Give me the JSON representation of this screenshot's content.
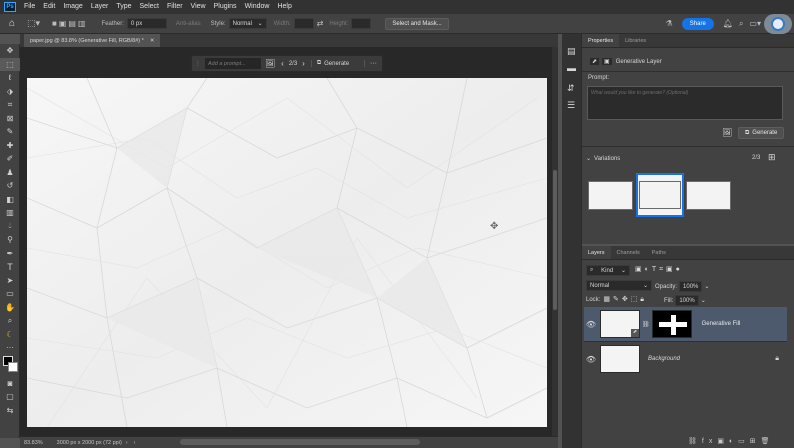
{
  "app": {
    "logo": "Ps"
  },
  "menu": [
    "File",
    "Edit",
    "Image",
    "Layer",
    "Type",
    "Select",
    "Filter",
    "View",
    "Plugins",
    "Window",
    "Help"
  ],
  "options": {
    "feather_label": "Feather:",
    "feather_value": "0 px",
    "anti_alias": "Anti-alias",
    "style_label": "Style:",
    "style_value": "Normal",
    "width_label": "Width:",
    "height_label": "Height:",
    "select_mask": "Select and Mask...",
    "share": "Share"
  },
  "document": {
    "tab_title": "paper.jpg @ 83.8% (Generative Fill, RGB/8#) *"
  },
  "context_bar": {
    "prompt_placeholder": "Add a prompt...",
    "counter": "2/3",
    "generate": "Generate",
    "more": "···"
  },
  "status": {
    "zoom": "83.83%",
    "dimensions": "3000 px x 2000 px (72 ppi)"
  },
  "properties": {
    "tabs": [
      "Properties",
      "Libraries"
    ],
    "layer_type": "Generative Layer",
    "prompt_label": "Prompt:",
    "prompt_placeholder": "What would you like to generate? (Optional)",
    "generate": "Generate",
    "variations_label": "Variations",
    "variations_count": "2/3",
    "selected_variation": 2
  },
  "layers": {
    "tabs": [
      "Layers",
      "Channels",
      "Paths"
    ],
    "kind": "Kind",
    "blend_mode": "Normal",
    "opacity_label": "Opacity:",
    "opacity_value": "100%",
    "lock_label": "Lock:",
    "fill_label": "Fill:",
    "fill_value": "100%",
    "items": [
      {
        "name": "Generative Fill",
        "selected": true
      },
      {
        "name": "Background",
        "selected": false
      }
    ]
  },
  "colors": {
    "accent": "#1473e6",
    "panel": "#424242",
    "canvas_bg": "#282828"
  }
}
